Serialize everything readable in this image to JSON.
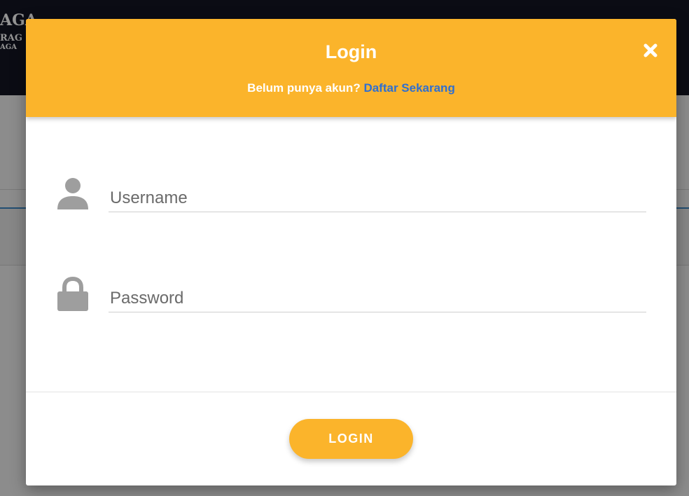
{
  "background": {
    "brand_line1": "AGA",
    "brand_line2": "RAG",
    "brand_line3": "AGA"
  },
  "modal": {
    "title": "Login",
    "subtitle_text": "Belum punya akun?",
    "signup_link": "Daftar Sekarang",
    "close_icon": "close-icon",
    "fields": {
      "username": {
        "placeholder": "Username",
        "value": "",
        "icon": "user-icon"
      },
      "password": {
        "placeholder": "Password",
        "value": "",
        "icon": "lock-icon"
      }
    },
    "login_button": "LOGIN"
  },
  "colors": {
    "accent": "#fbb42b",
    "link": "#2f6fd0",
    "topbar": "#141624"
  }
}
